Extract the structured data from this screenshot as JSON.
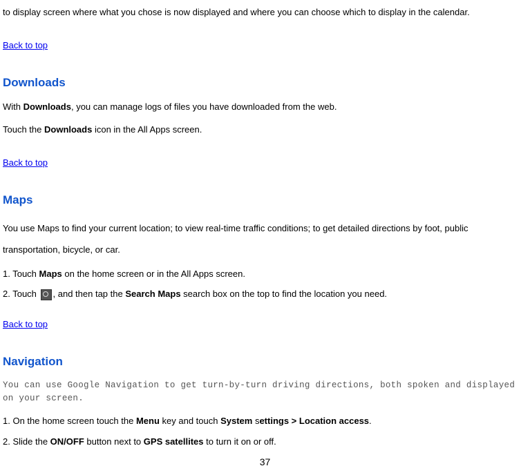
{
  "intro_fragment": "to display screen where what you chose is now displayed and where you can choose which to display in the calendar.",
  "back_to_top": "Back to top",
  "downloads": {
    "heading": "Downloads",
    "line1_pre": "With ",
    "line1_bold": "Downloads",
    "line1_post": ", you can manage logs of files you have downloaded from the web.",
    "line2_pre": "Touch the ",
    "line2_bold": "Downloads",
    "line2_post": " icon in the All Apps screen."
  },
  "maps": {
    "heading": "Maps",
    "desc": "You use Maps to find your current location; to view real-time traffic conditions; to get detailed directions by foot, public transportation, bicycle, or car.",
    "step1_pre": "1. Touch ",
    "step1_bold": "Maps",
    "step1_post": " on the home screen or in the All Apps screen.",
    "step2_pre": "2. Touch ",
    "step2_mid": ", and then tap the ",
    "step2_bold": "Search Maps",
    "step2_post": " search box on the top to find the location you need."
  },
  "navigation": {
    "heading": "Navigation",
    "desc": "You can use Google Navigation to get turn-by-turn driving directions, both spoken and displayed on your screen.",
    "step1_pre": "1. On the home screen touch the ",
    "step1_b1": "Menu",
    "step1_mid1": " key and touch ",
    "step1_b2": "System",
    "step1_mid2": " s",
    "step1_b3": "ettings > Location access",
    "step1_post": ".",
    "step2_pre": "2. Slide the ",
    "step2_b1": "ON/OFF",
    "step2_mid": " button next to ",
    "step2_b2": "GPS satellites",
    "step2_post": " to turn it on or off."
  },
  "page_number": "37"
}
